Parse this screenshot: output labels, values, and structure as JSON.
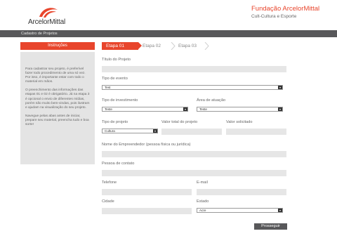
{
  "header": {
    "logo_text": "ArcelorMittal",
    "brand_title": "Fundação ArcelorMittal",
    "brand_subtitle": "Cult-Cultura e Esporte"
  },
  "topbar": {
    "label": "Cadastro de Projetos"
  },
  "sidebar": {
    "title": "Instruções",
    "paragraphs": [
      "Para cadastrar seu projeto, é preferível fazer todo procedimento de uma só vez. Por isso, é importante estar com todo o material em mãos.",
      "O preenchimento das informações das etapas 01 e 02 é obrigatório. Já na etapa 3 é opcional o envio de diferentes mídias, porém são muito bem-vindas, pois ilustram e ajudam na visualização do seu projeto.",
      "Navegue pelas abas antes de iniciar, prepare seu material, preencha tudo e boa sorte!"
    ]
  },
  "steps": [
    "Etapa 01",
    "Etapa 02",
    "Etapa 03"
  ],
  "form": {
    "titulo_label": "Título do Projeto",
    "tipo_evento_label": "Tipo de evento",
    "tipo_evento_value": "Test",
    "tipo_investimento_label": "Tipo de investimento",
    "tipo_investimento_value": "Teste",
    "area_atuacao_label": "Área de atuação",
    "area_atuacao_value": "Teste",
    "tipo_projeto_label": "Tipo de projeto",
    "tipo_projeto_value": "Cultura",
    "valor_total_label": "Valor total do projeto",
    "valor_solicitado_label": "Valor solicitado",
    "empreendedor_label": "Nome do Empreendedor (pessoa física ou jurídica)",
    "contato_label": "Pessoa de contato",
    "telefone_label": "Telefone",
    "email_label": "E-mail",
    "cidade_label": "Cidade",
    "estado_label": "Estado",
    "estado_value": "Acre",
    "submit_label": "Prosseguir"
  },
  "colors": {
    "accent": "#e8452c",
    "bar": "#58585a",
    "field": "#e6e6e6",
    "panel": "#e4e4e4"
  },
  "icons": {
    "logo": "arcelormittal-arc-logo",
    "select": "chevron-down-icon",
    "steps": "chevron-right-icon"
  }
}
